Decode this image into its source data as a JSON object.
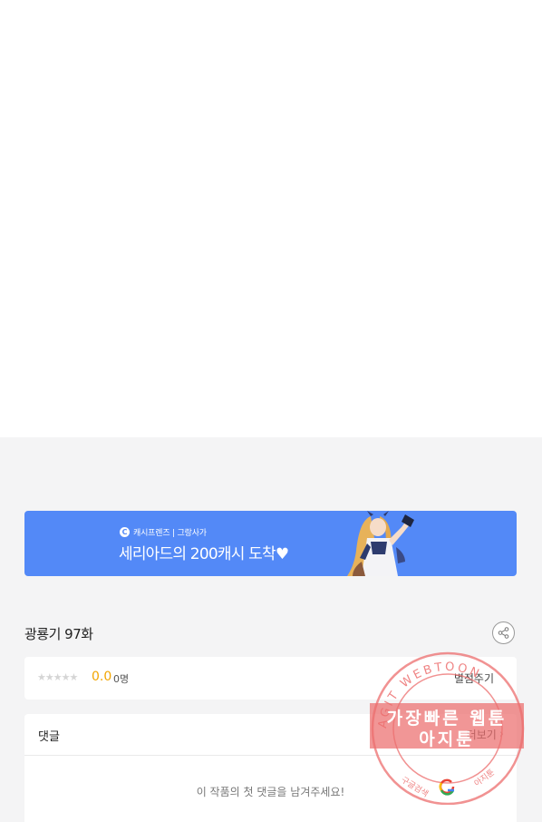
{
  "banner": {
    "brand": "캐시프렌즈 | 그랑사가",
    "headline": "세리아드의 200캐시 도착",
    "heart": "♥"
  },
  "episode": {
    "title": "광룡기 97화"
  },
  "rating": {
    "stars": "★★★★★",
    "score": "0.0",
    "count": "0명",
    "rate_label": "별점주기"
  },
  "comments": {
    "title": "댓글",
    "more_label": "더보기",
    "empty_text": "이 작품의 첫 댓글을 남겨주세요!"
  },
  "watermark": {
    "ring_text": "AGIT WEBTOON",
    "line1": "가장빠른 웹툰",
    "line2": "아지툰",
    "bottom_left": "구글검색",
    "bottom_right": "아지툰",
    "google_letter": "G"
  },
  "colors": {
    "banner_bg": "#5389f7",
    "score": "#f2a500",
    "watermark": "#ec6e6e",
    "page_bg": "#f4f4f5"
  },
  "icons": [
    "share-icon",
    "chevron-right-icon",
    "cashfriends-logo-icon",
    "google-g-icon"
  ]
}
